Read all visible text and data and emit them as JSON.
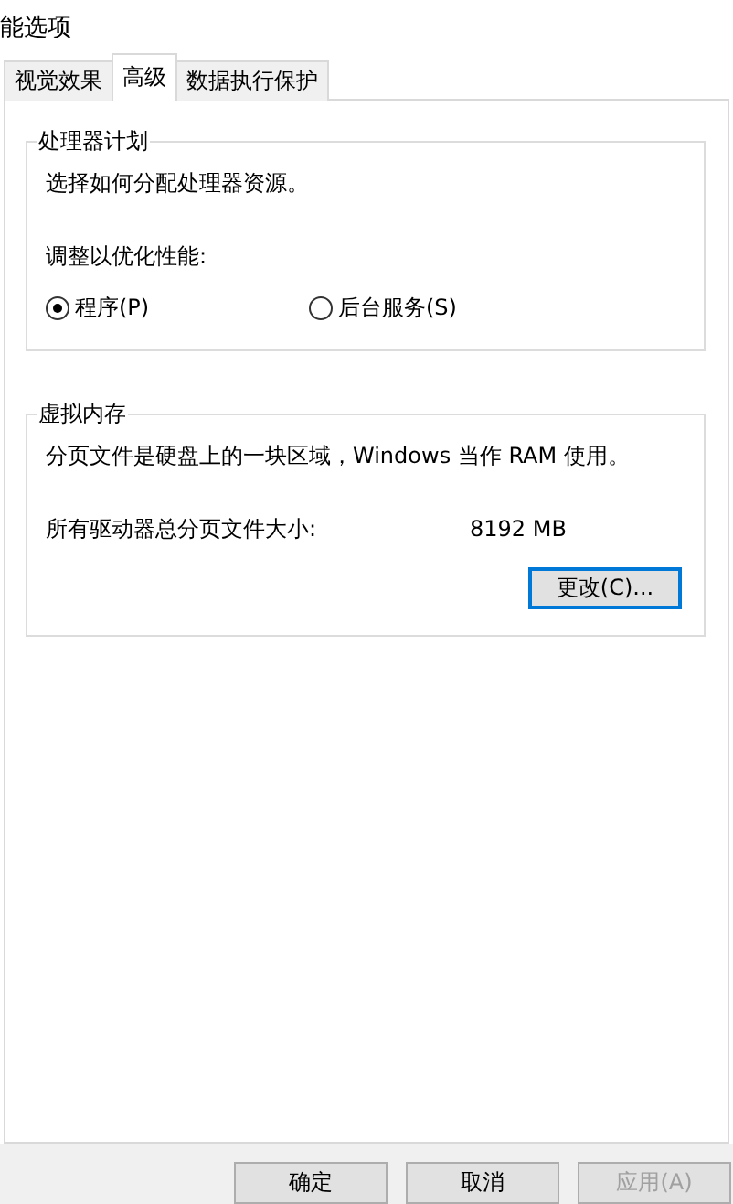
{
  "window": {
    "title": "能选项"
  },
  "tabs": [
    {
      "label": "视觉效果",
      "selected": false
    },
    {
      "label": "高级",
      "selected": true
    },
    {
      "label": "数据执行保护",
      "selected": false
    }
  ],
  "processor_scheduling": {
    "title": "处理器计划",
    "description": "选择如何分配处理器资源。",
    "prompt": "调整以优化性能:",
    "options": [
      {
        "label": "程序(P)",
        "selected": true
      },
      {
        "label": "后台服务(S)",
        "selected": false
      }
    ]
  },
  "virtual_memory": {
    "title": "虚拟内存",
    "description": "分页文件是硬盘上的一块区域，Windows 当作 RAM 使用。",
    "total_label": "所有驱动器总分页文件大小:",
    "total_value": "8192 MB",
    "button": {
      "label": "更改(C)...",
      "focused": true
    }
  },
  "buttons": [
    {
      "label": "确定",
      "disabled": false
    },
    {
      "label": "取消",
      "disabled": false
    },
    {
      "label": "应用(A)",
      "disabled": true
    }
  ]
}
